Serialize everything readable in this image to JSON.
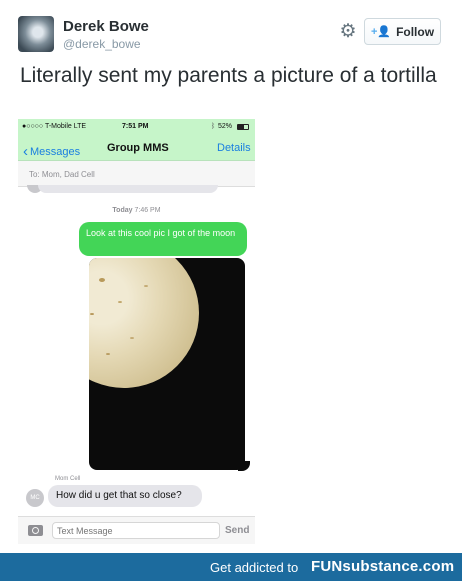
{
  "tweet": {
    "user_name": "Derek Bowe",
    "user_handle": "@derek_bowe",
    "follow_label": "Follow",
    "text": "Literally sent my parents a picture of a tortilla"
  },
  "phone": {
    "status": {
      "carrier": "●○○○○ T-Mobile  LTE",
      "time": "7:51 PM",
      "battery": "52%"
    },
    "nav": {
      "back_label": "Messages",
      "title": "Group MMS",
      "details_label": "Details"
    },
    "to_field": "To: Mom, Dad Cell",
    "timestamp_day": "Today",
    "timestamp_time": "7:46 PM",
    "sent_message": "Look at this cool pic I got of the moon",
    "sender_name": "Mom Cell",
    "sender_initials": "MC",
    "received_message": "How did u get that so close?",
    "input_placeholder": "Text Message",
    "send_label": "Send"
  },
  "banner": {
    "tagline": "Get addicted to",
    "brand": "FUNsubstance.com"
  },
  "icons": {
    "gear": "gear-icon",
    "follow": "add-user-icon",
    "back": "chevron-left-icon",
    "camera": "camera-icon",
    "bluetooth": "bluetooth-icon"
  },
  "colors": {
    "imessage_green": "#43d557",
    "status_green": "#c6f5c9",
    "ios_blue": "#1a7fe0",
    "banner_blue": "#1c6b9e",
    "twitter_blue": "#55acee"
  }
}
